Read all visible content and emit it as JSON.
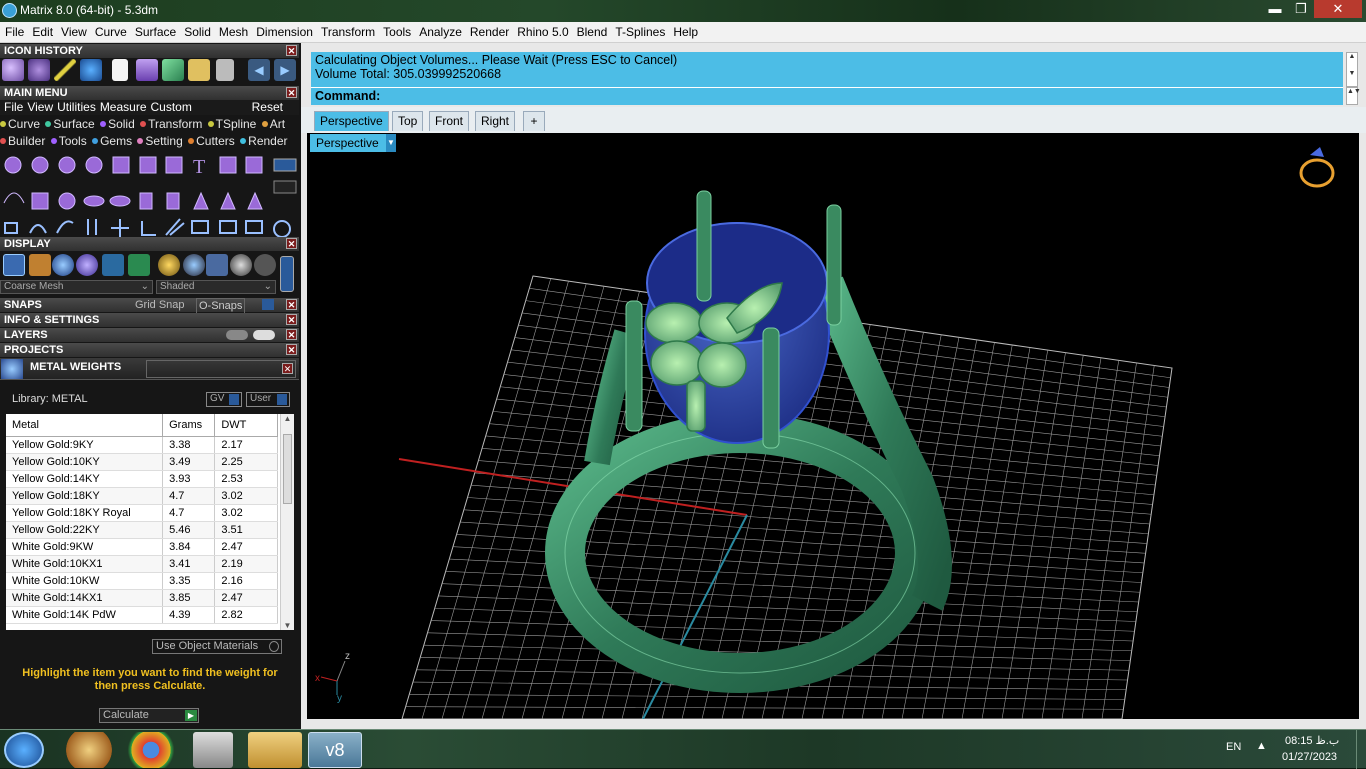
{
  "window": {
    "title": "Matrix 8.0 (64-bit) - 5.3dm",
    "minimize": "▬",
    "restore": "❐",
    "close": "✕"
  },
  "menu": [
    "File",
    "Edit",
    "View",
    "Curve",
    "Surface",
    "Solid",
    "Mesh",
    "Dimension",
    "Transform",
    "Tools",
    "Analyze",
    "Render",
    "Rhino 5.0",
    "Blend",
    "T-Splines",
    "Help"
  ],
  "panels": {
    "icon_history": "ICON HISTORY",
    "main_menu": "MAIN MENU",
    "main_menu_tabs": [
      "File",
      "View",
      "Utilities",
      "Measure",
      "Custom"
    ],
    "reset": "Reset",
    "categories_row1": [
      {
        "label": "Curve",
        "color": "#c8c840"
      },
      {
        "label": "Surface",
        "color": "#40c8a0"
      },
      {
        "label": "Solid",
        "color": "#a060ff"
      },
      {
        "label": "Transform",
        "color": "#e05050"
      },
      {
        "label": "TSpline",
        "color": "#c8c840"
      },
      {
        "label": "Art",
        "color": "#e0a040"
      }
    ],
    "categories_row2": [
      {
        "label": "Builder",
        "color": "#e05050"
      },
      {
        "label": "Tools",
        "color": "#a060ff"
      },
      {
        "label": "Gems",
        "color": "#40a0e0"
      },
      {
        "label": "Setting",
        "color": "#e080c0"
      },
      {
        "label": "Cutters",
        "color": "#e08030"
      },
      {
        "label": "Render",
        "color": "#40c0e0"
      }
    ],
    "display": "DISPLAY",
    "mesh_select": "Coarse Mesh",
    "shade_select": "Shaded",
    "snaps": "SNAPS",
    "grid_snap": "Grid Snap",
    "osnaps": "O-Snaps",
    "info": "INFO & SETTINGS",
    "layers": "LAYERS",
    "projects": "PROJECTS",
    "metal_weights": "METAL WEIGHTS",
    "library": "Library: METAL",
    "gv": "GV",
    "user": "User",
    "use_object_materials": "Use Object Materials",
    "hint": "Highlight the item you want to find the weight for then press Calculate.",
    "calculate": "Calculate"
  },
  "weights": {
    "headers": [
      "Metal",
      "Grams",
      "DWT"
    ],
    "rows": [
      [
        "Yellow Gold:9KY",
        "3.38",
        "2.17"
      ],
      [
        "Yellow Gold:10KY",
        "3.49",
        "2.25"
      ],
      [
        "Yellow Gold:14KY",
        "3.93",
        "2.53"
      ],
      [
        "Yellow Gold:18KY",
        "4.7",
        "3.02"
      ],
      [
        "Yellow Gold:18KY Royal",
        "4.7",
        "3.02"
      ],
      [
        "Yellow Gold:22KY",
        "5.46",
        "3.51"
      ],
      [
        "White Gold:9KW",
        "3.84",
        "2.47"
      ],
      [
        "White Gold:10KX1",
        "3.41",
        "2.19"
      ],
      [
        "White Gold:10KW",
        "3.35",
        "2.16"
      ],
      [
        "White Gold:14KX1",
        "3.85",
        "2.47"
      ],
      [
        "White Gold:14K PdW",
        "4.39",
        "2.82"
      ]
    ]
  },
  "command": {
    "line1": "Calculating Object Volumes... Please Wait (Press ESC to Cancel)",
    "line2": "Volume Total: 305.039992520668",
    "prompt": "Command:"
  },
  "viewport_tabs": [
    "Perspective",
    "Top",
    "Front",
    "Right"
  ],
  "add_tab": "+",
  "viewport_label": "Perspective",
  "axes": {
    "z": "z",
    "x": "x",
    "y": "y"
  },
  "taskbar": {
    "lang": "EN",
    "time": "08:15 ب.ظ",
    "date": "01/27/2023"
  }
}
